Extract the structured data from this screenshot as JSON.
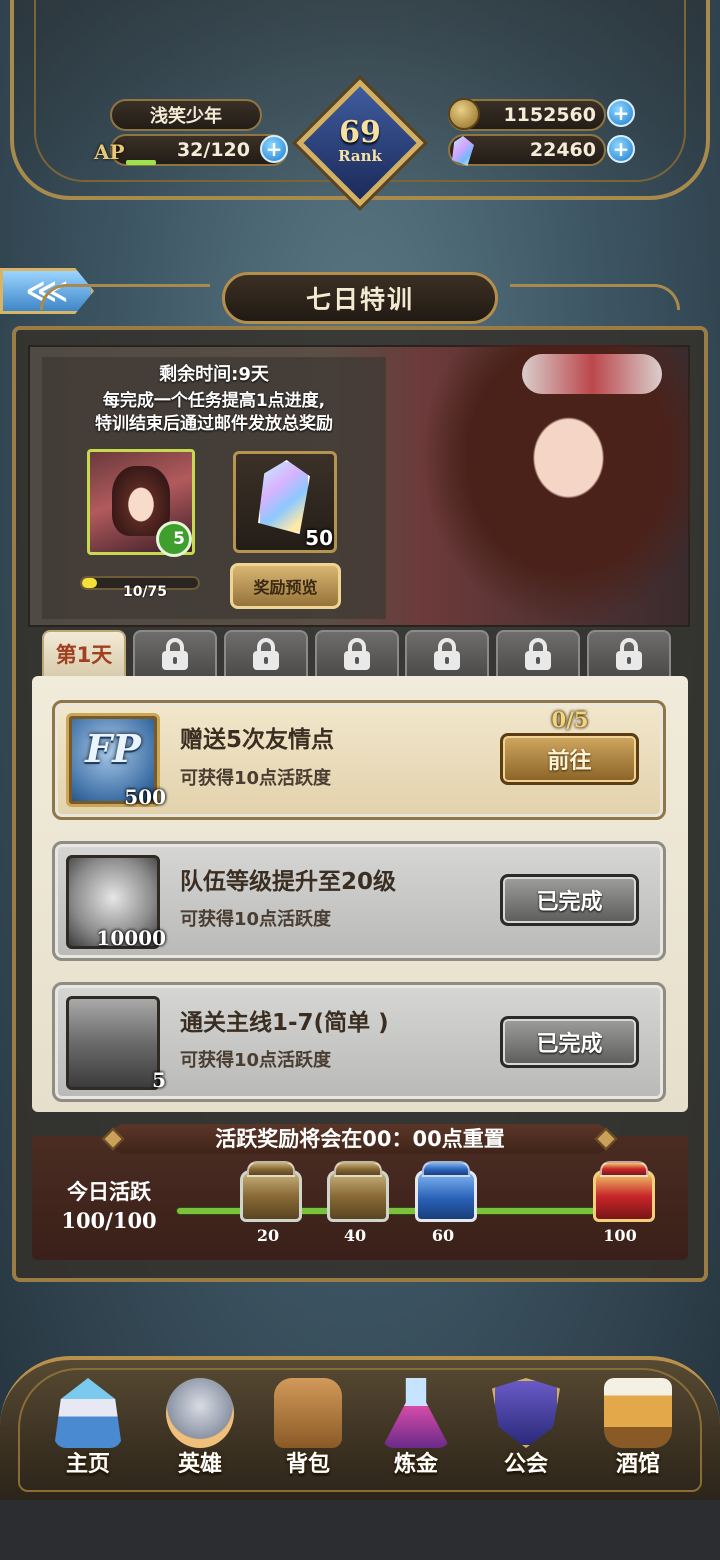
{
  "header": {
    "player_name": "浅笑少年",
    "ap_label": "AP",
    "ap_value": "32/120",
    "ap_fraction": 0.27,
    "rank_number": "69",
    "rank_label": "Rank",
    "gold": "1152560",
    "gems": "22460",
    "plus_symbol": "+"
  },
  "page": {
    "back_symbol": "⋘",
    "title": "七日特训"
  },
  "banner": {
    "remaining": "剩余时间:9天",
    "desc_line1": "每完成一个任务提高1点进度,",
    "desc_line2": "特训结束后通过邮件发放总奖励",
    "hero_level": "5",
    "crystal_count": "50",
    "progress_text": "10/75",
    "progress_fraction": 0.133,
    "preview_button": "奖励预览"
  },
  "tabs": {
    "active_label": "第1天",
    "locked": [
      {
        "name": "tab-day-2"
      },
      {
        "name": "tab-day-3"
      },
      {
        "name": "tab-day-4"
      },
      {
        "name": "tab-day-5"
      },
      {
        "name": "tab-day-6"
      },
      {
        "name": "tab-day-7"
      }
    ]
  },
  "tasks": [
    {
      "title": "赠送5次友情点",
      "subtitle": "可获得10点活跃度",
      "icon": "friendship-point-icon",
      "icon_text": "FP",
      "reward_count": "500",
      "progress": "0/5",
      "button": "前往",
      "state": "active"
    },
    {
      "title": "队伍等级提升至20级",
      "subtitle": "可获得10点活跃度",
      "icon": "silver-coin-icon",
      "reward_count": "10000",
      "button": "已完成",
      "state": "done"
    },
    {
      "title": "通关主线1-7(简单 )",
      "subtitle": "可获得10点活跃度",
      "icon": "treasure-chest-icon",
      "reward_count": "5",
      "button": "已完成",
      "state": "done"
    }
  ],
  "activity": {
    "reset_text": "活跃奖励将会在00：00点重置",
    "today_label": "今日活跃",
    "today_value": "100/100",
    "milestones": [
      {
        "threshold": "20",
        "chest": "bronze"
      },
      {
        "threshold": "40",
        "chest": "bronze"
      },
      {
        "threshold": "60",
        "chest": "blue"
      },
      {
        "threshold": "100",
        "chest": "red"
      }
    ]
  },
  "nav": [
    {
      "label": "主页",
      "icon": "castle-icon"
    },
    {
      "label": "英雄",
      "icon": "helmet-icon"
    },
    {
      "label": "背包",
      "icon": "bag-icon"
    },
    {
      "label": "炼金",
      "icon": "potion-icon"
    },
    {
      "label": "公会",
      "icon": "shield-icon"
    },
    {
      "label": "酒馆",
      "icon": "beer-mug-icon"
    }
  ],
  "colors": {
    "gold_frame": "#a88a4c",
    "progress_yellow": "#f4e03a",
    "activity_green": "#7ac23c",
    "plus_blue": "#1c7cd0"
  }
}
